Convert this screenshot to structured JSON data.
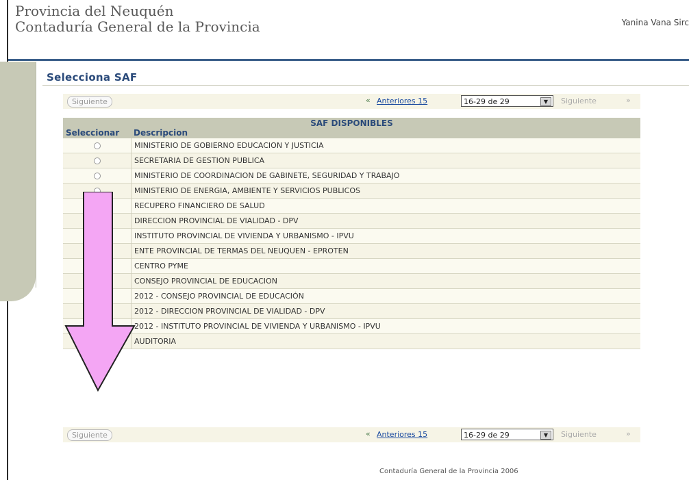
{
  "header": {
    "org_line1": "Provincia del Neuquén",
    "org_line2": "Contaduría General de la Provincia",
    "user_name": "Yanina Vana Sirc"
  },
  "page": {
    "title": "Selecciona SAF"
  },
  "pager_top": {
    "next_button": "Siguiente",
    "prev_link": "Anteriores 15",
    "range_value": "16-29 de 29",
    "next_text": "Siguiente"
  },
  "pager_bottom": {
    "next_button": "Siguiente",
    "prev_link": "Anteriores 15",
    "range_value": "16-29 de 29",
    "next_text": "Siguiente"
  },
  "table": {
    "group_header": "SAF DISPONIBLES",
    "columns": [
      "Seleccionar",
      "Descripcion"
    ],
    "rows": [
      "MINISTERIO DE GOBIERNO EDUCACION Y JUSTICIA",
      "SECRETARIA DE GESTION PUBLICA",
      "MINISTERIO DE COORDINACION DE GABINETE, SEGURIDAD Y TRABAJO",
      "MINISTERIO DE ENERGIA, AMBIENTE Y SERVICIOS PUBLICOS",
      "RECUPERO FINANCIERO DE SALUD",
      "DIRECCION PROVINCIAL DE VIALIDAD - DPV",
      "INSTITUTO PROVINCIAL DE VIVIENDA Y URBANISMO - IPVU",
      "ENTE PROVINCIAL DE TERMAS DEL NEUQUEN - EPROTEN",
      "CENTRO PYME",
      "CONSEJO PROVINCIAL DE EDUCACION",
      "2012 - CONSEJO PROVINCIAL DE EDUCACIÓN",
      "2012 - DIRECCION PROVINCIAL DE VIALIDAD - DPV",
      "2012 - INSTITUTO PROVINCIAL DE VIVIENDA Y URBANISMO - IPVU",
      "AUDITORIA"
    ]
  },
  "footer": {
    "text": "Contaduría General de la Provincia 2006"
  },
  "colors": {
    "accent_blue": "#2a4a7a",
    "header_band": "#c7c9b6",
    "arrow_fill": "#f4a6f4"
  },
  "icons": {
    "prev": "double-chevron-left-icon",
    "next": "double-chevron-right-icon",
    "dropdown": "chevron-down-icon",
    "annotation": "down-arrow-annotation"
  }
}
